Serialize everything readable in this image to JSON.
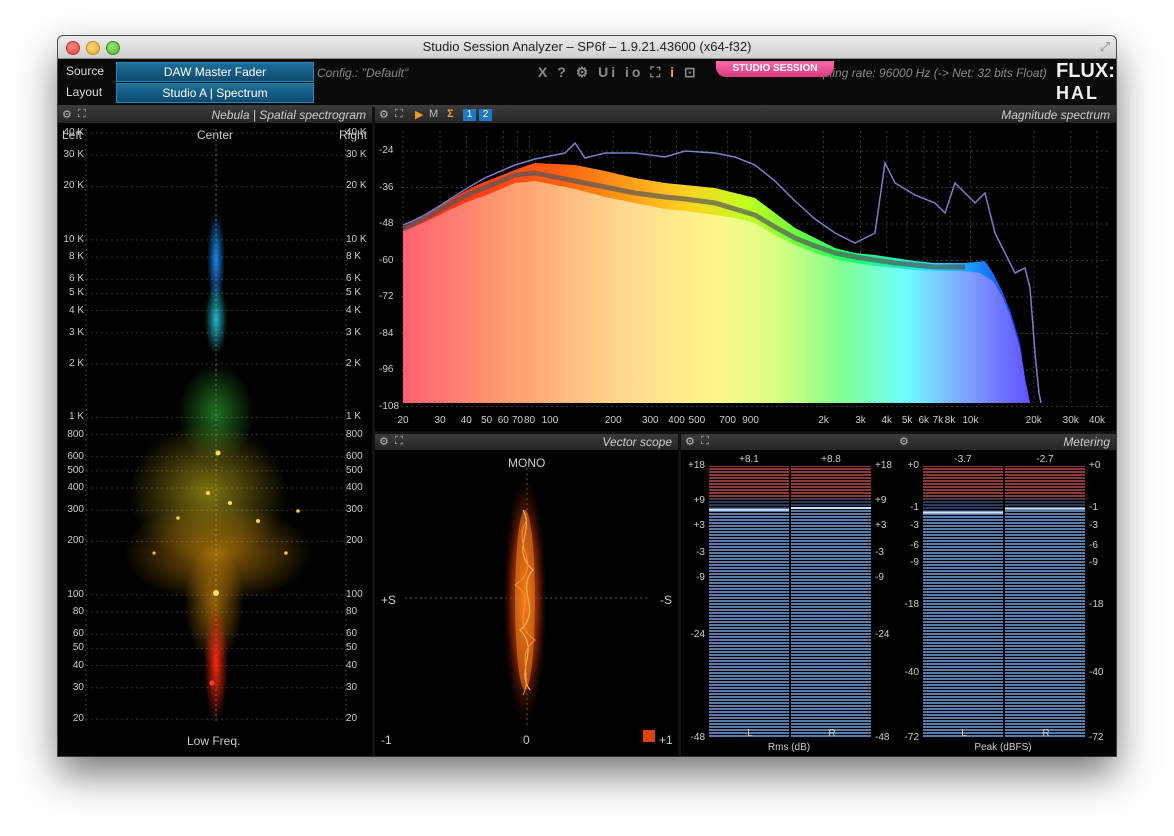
{
  "window": {
    "title": "Studio Session Analyzer – SP6f – 1.9.21.43600 (x64-f32)",
    "expand_icon": "⤢"
  },
  "header": {
    "source_label": "Source",
    "source_value": "DAW Master Fader",
    "layout_label": "Layout",
    "layout_value": "Studio A | Spectrum",
    "config": "Config.: \"Default\"",
    "toolbar_icons": {
      "close": "X",
      "help": "?",
      "settings": "⚙",
      "ui": "Ui",
      "io": "io",
      "fullscreen": "⛶",
      "info": "i",
      "screen": "⊡"
    },
    "badge": "STUDIO SESSION",
    "sampling": "pling rate: 96000 Hz (-> Net: 32 bits Float)",
    "logo_top": "FLUX::",
    "logo_bottom": "HAL"
  },
  "nebula": {
    "title": "Nebula | Spatial spectrogram",
    "left": "Left",
    "center": "Center",
    "right": "Right",
    "bottom": "Low Freq.",
    "freq_labels": [
      "40 K",
      "30 K",
      "20 K",
      "10 K",
      "8 K",
      "6 K",
      "5 K",
      "4 K",
      "3 K",
      "2 K",
      "1 K",
      "800",
      "600",
      "500",
      "400",
      "300",
      "200",
      "100",
      "80",
      "60",
      "50",
      "40",
      "30",
      "20"
    ]
  },
  "magnitude": {
    "title": "Magnitude spectrum",
    "db_labels": [
      "-24",
      "-36",
      "-48",
      "-60",
      "-72",
      "-84",
      "-96",
      "-108"
    ],
    "freq_labels": [
      "20",
      "30",
      "40",
      "50",
      "60",
      "70",
      "80",
      "100",
      "200",
      "300",
      "400",
      "500",
      "700",
      "900",
      "2k",
      "3k",
      "4k",
      "5k",
      "6k",
      "7k",
      "8k",
      "10k",
      "20k",
      "30k",
      "40k"
    ],
    "toolbar": {
      "play": "▶",
      "m": "M",
      "sigma": "Σ",
      "one": "1",
      "two": "2"
    }
  },
  "vector": {
    "title": "Vector scope",
    "mono": "MONO",
    "plus_s": "+S",
    "minus_s": "-S",
    "minus_one": "-1",
    "zero": "0",
    "plus_one": "+1"
  },
  "metering": {
    "title": "Metering",
    "rms": {
      "caption": "Rms (dB)",
      "left_value": "+8.1",
      "right_value": "+8.8",
      "scale": [
        "+18",
        "+9",
        "+3",
        "-3",
        "-9",
        "-24",
        "-48"
      ],
      "ch_left": "L",
      "ch_right": "R",
      "level_left": 0.843,
      "level_right": 0.849
    },
    "peak": {
      "caption": "Peak (dBFS)",
      "left_value": "-3.7",
      "right_value": "-2.7",
      "scale": [
        "+0",
        "-1",
        "-3",
        "-6",
        "-9",
        "-18",
        "-40",
        "-72"
      ],
      "ch_left": "L",
      "ch_right": "R",
      "level_left": 0.833,
      "level_right": 0.847
    }
  },
  "colors": {
    "accent_blue": "#1d6e99",
    "badge_pink": "#e14b8e",
    "info_orange": "#f0a020"
  }
}
